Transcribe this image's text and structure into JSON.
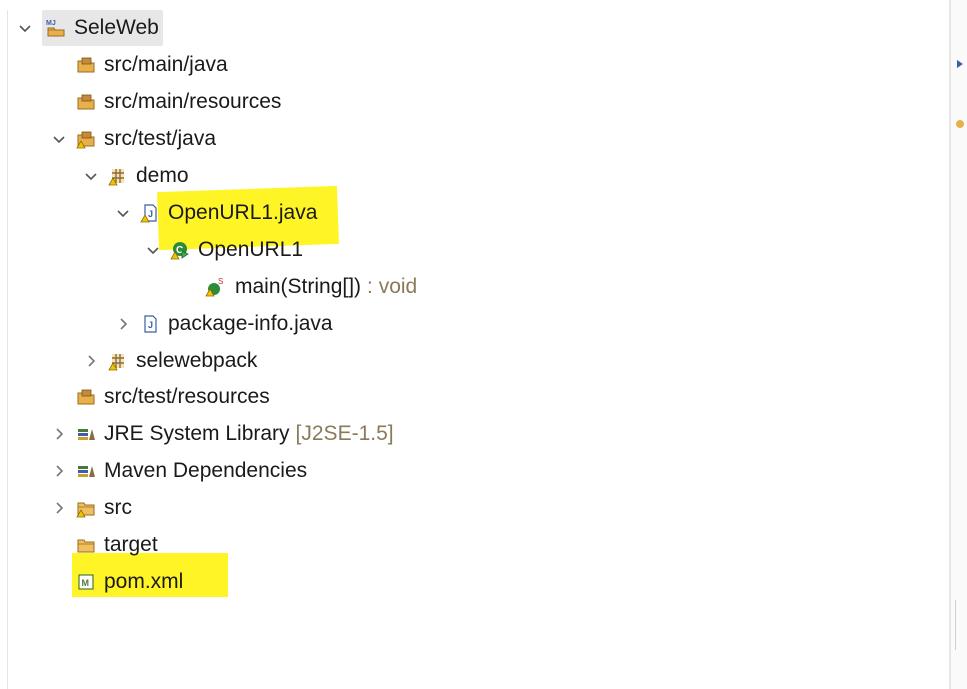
{
  "tree": {
    "project": {
      "label": "SeleWeb"
    },
    "items": [
      {
        "label": "src/main/java"
      },
      {
        "label": "src/main/resources"
      },
      {
        "label": "src/test/java"
      },
      {
        "label": "demo"
      },
      {
        "label": "OpenURL1.java"
      },
      {
        "label": "OpenURL1"
      },
      {
        "label": "main(String[])",
        "decoration": ": void"
      },
      {
        "label": "package-info.java"
      },
      {
        "label": "selewebpack"
      },
      {
        "label": "src/test/resources"
      },
      {
        "label": "JRE System Library",
        "decoration": "[J2SE-1.5]"
      },
      {
        "label": "Maven Dependencies"
      },
      {
        "label": "src"
      },
      {
        "label": "target"
      },
      {
        "label": "pom.xml"
      }
    ]
  },
  "colors": {
    "highlight": "#fff200",
    "selection": "#e7e7e7",
    "decoration": "#8a7a5a",
    "package_folder": "#8a6d3b",
    "java_file": "#3a5fa8",
    "class_green": "#2e8b3a"
  }
}
